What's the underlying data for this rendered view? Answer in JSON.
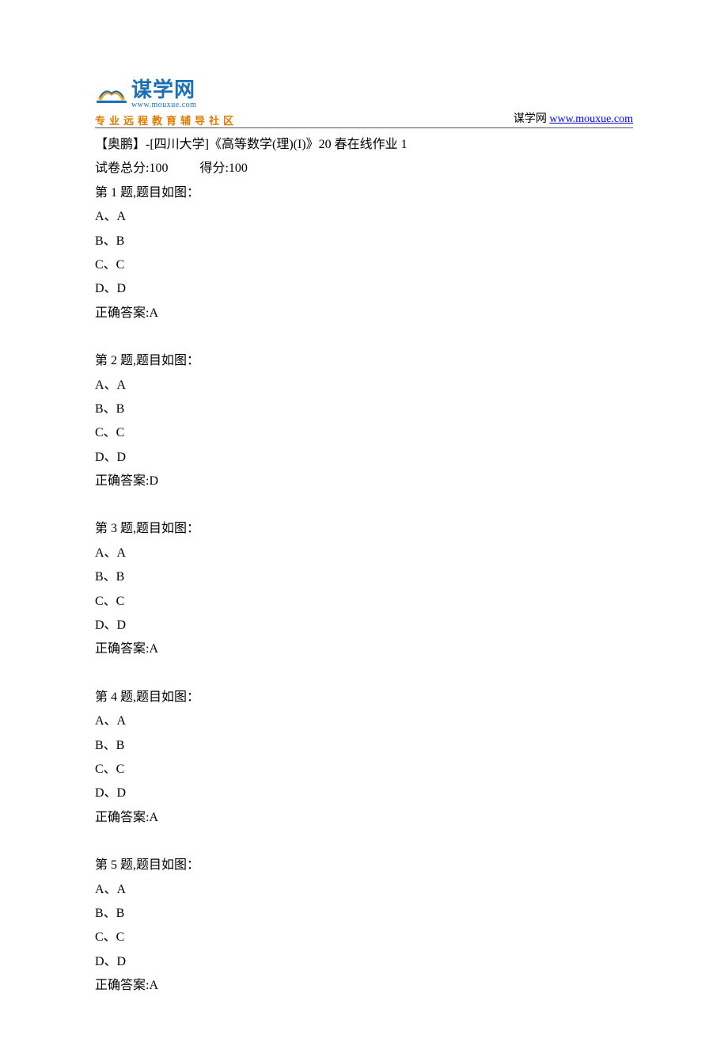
{
  "header": {
    "logo_cn": "谋学网",
    "logo_url": "www.mouxue.com",
    "logo_tagline": "专业远程教育辅导社区",
    "right_label": "谋学网",
    "right_link_text": "www.mouxue.com"
  },
  "doc": {
    "title": "【奥鹏】-[四川大学]《高等数学(理)(I)》20 春在线作业 1",
    "score_total_label": "试卷总分:100",
    "score_got_label": "得分:100"
  },
  "questions": [
    {
      "heading": "第 1 题,题目如图：",
      "options": [
        "A、A",
        "B、B",
        "C、C",
        "D、D"
      ],
      "answer": "正确答案:A"
    },
    {
      "heading": "第 2 题,题目如图：",
      "options": [
        "A、A",
        "B、B",
        "C、C",
        "D、D"
      ],
      "answer": "正确答案:D"
    },
    {
      "heading": "第 3 题,题目如图：",
      "options": [
        "A、A",
        "B、B",
        "C、C",
        "D、D"
      ],
      "answer": "正确答案:A"
    },
    {
      "heading": "第 4 题,题目如图：",
      "options": [
        "A、A",
        "B、B",
        "C、C",
        "D、D"
      ],
      "answer": "正确答案:A"
    },
    {
      "heading": "第 5 题,题目如图：",
      "options": [
        "A、A",
        "B、B",
        "C、C",
        "D、D"
      ],
      "answer": "正确答案:A"
    }
  ]
}
